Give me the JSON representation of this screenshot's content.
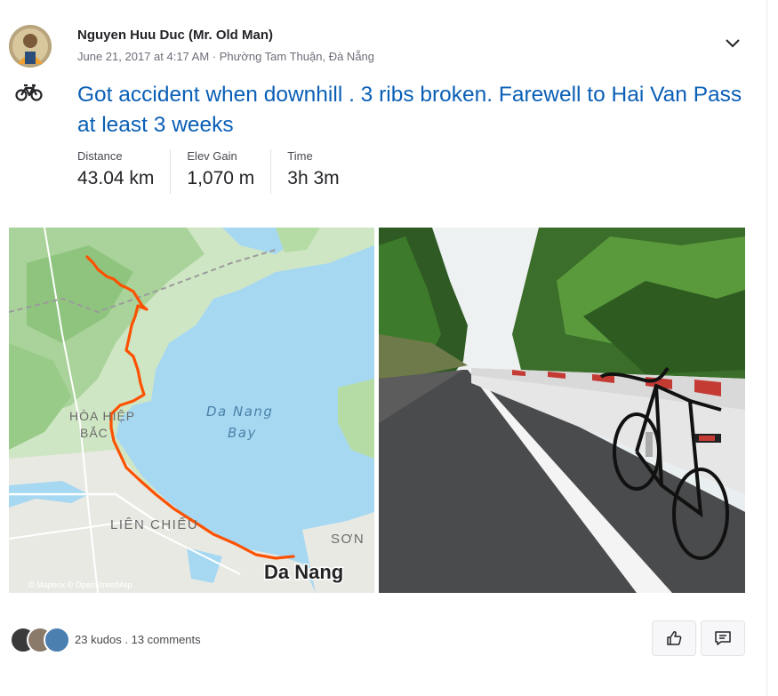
{
  "athlete": {
    "name": "Nguyen Huu Duc (Mr. Old Man)",
    "meta": "June 21, 2017 at 4:17 AM · Phường Tam Thuận, Đà Nẵng"
  },
  "activity": {
    "sport_icon": "bike-icon",
    "title": "Got accident when downhill . 3 ribs broken. Farewell to Hai Van Pass at least 3 weeks"
  },
  "stats": [
    {
      "label": "Distance",
      "value": "43.04 km"
    },
    {
      "label": "Elev Gain",
      "value": "1,070 m"
    },
    {
      "label": "Time",
      "value": "3h 3m"
    }
  ],
  "map": {
    "labels": {
      "hoa_hiep_1": "HÒA HIỆP",
      "hoa_hiep_2": "BẮC",
      "bay_1": "Da Nang",
      "bay_2": "Bay",
      "lien_chieu": "LIÊN CHIỂU",
      "son": "SƠN",
      "da_nang": "Da Nang",
      "attribution": "© Mapbox © OpenStreetMap"
    },
    "route_color": "#fc5200"
  },
  "social": {
    "kudos": "23 kudos",
    "separator": " . ",
    "comments": "13 comments"
  },
  "colors": {
    "title": "#0a5fb6",
    "route": "#fc5200",
    "water": "#a6d8f2"
  }
}
